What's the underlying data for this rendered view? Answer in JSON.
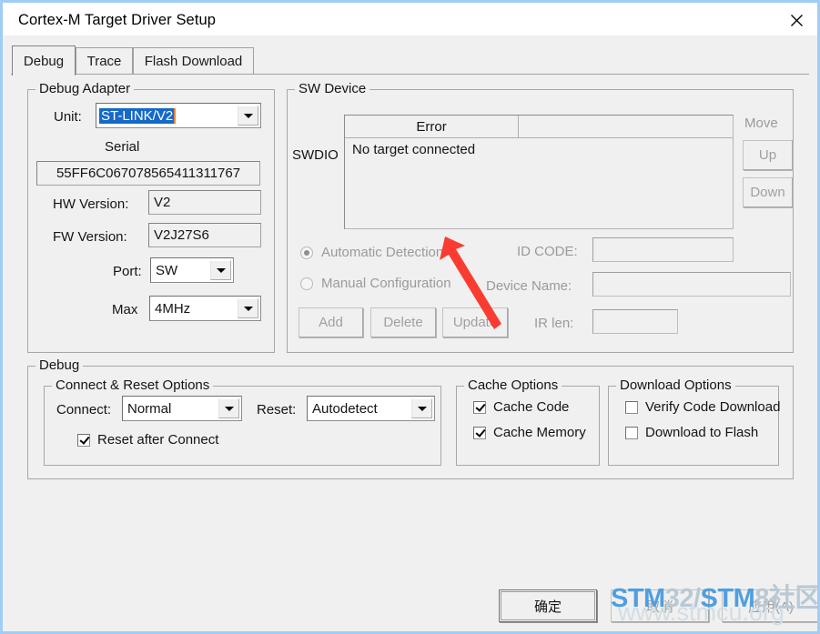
{
  "window": {
    "title": "Cortex-M Target Driver Setup",
    "close_icon": "close-icon"
  },
  "tabs": [
    {
      "label": "Debug",
      "active": true
    },
    {
      "label": "Trace",
      "active": false
    },
    {
      "label": "Flash Download",
      "active": false
    }
  ],
  "debug_adapter": {
    "legend": "Debug Adapter",
    "unit_label": "Unit:",
    "unit_value": "ST-LINK/V2",
    "serial_label": "Serial",
    "serial_value": "55FF6C067078565411311767",
    "hw_version_label": "HW Version:",
    "hw_version_value": "V2",
    "fw_version_label": "FW Version:",
    "fw_version_value": "V2J27S6",
    "port_label": "Port:",
    "port_value": "SW",
    "max_label": "Max",
    "max_value": "4MHz"
  },
  "sw_device": {
    "legend": "SW Device",
    "swdio_label": "SWDIO",
    "column_headers": [
      "Error",
      ""
    ],
    "rows": [
      "No target connected"
    ],
    "move_label": "Move",
    "up_label": "Up",
    "down_label": "Down",
    "automatic_detection_label": "Automatic Detection",
    "manual_configuration_label": "Manual Configuration",
    "id_code_label": "ID CODE:",
    "id_code_value": "",
    "device_name_label": "Device Name:",
    "device_name_value": "",
    "ir_len_label": "IR len:",
    "ir_len_value": "",
    "add_label": "Add",
    "delete_label": "Delete",
    "update_label": "Update"
  },
  "debug_group": {
    "legend": "Debug",
    "connect_reset": {
      "legend": "Connect & Reset Options",
      "connect_label": "Connect:",
      "connect_value": "Normal",
      "reset_label": "Reset:",
      "reset_value": "Autodetect",
      "reset_after_connect_label": "Reset after Connect",
      "reset_after_connect_checked": true
    },
    "cache_options": {
      "legend": "Cache Options",
      "cache_code_label": "Cache Code",
      "cache_code_checked": true,
      "cache_memory_label": "Cache Memory",
      "cache_memory_checked": true
    },
    "download_options": {
      "legend": "Download Options",
      "verify_code_download_label": "Verify Code Download",
      "verify_code_download_checked": false,
      "download_to_flash_label": "Download to Flash",
      "download_to_flash_checked": false
    }
  },
  "footer": {
    "ok_label": "确定",
    "cancel_label": "取消",
    "apply_label": "应用(A)"
  },
  "watermark": {
    "part1": "STM",
    "part2": "32/",
    "part3": "STM",
    "part4": "8社区",
    "url": "www.stmcu.org"
  },
  "annotation": {
    "arrow_color": "#fa3b32"
  },
  "colors": {
    "selection_blue": "#1669c7",
    "window_frame": "#9fcdf5",
    "dialog_bg": "#f0f0f0"
  }
}
